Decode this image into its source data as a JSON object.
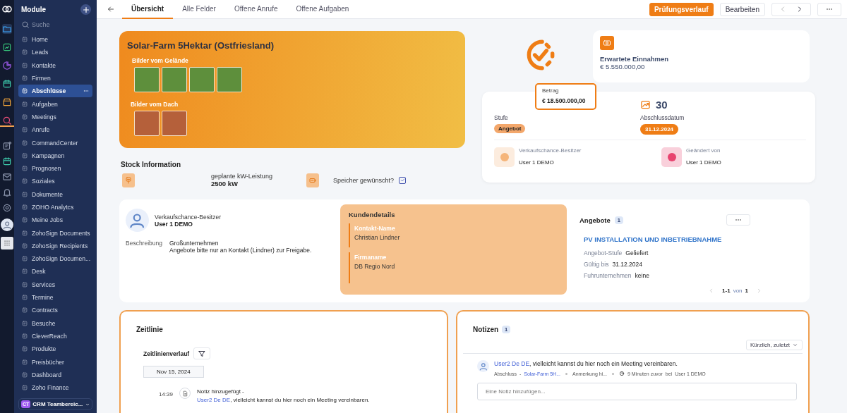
{
  "rail": {
    "top": [
      {
        "kind": "logo",
        "selected": false
      },
      {
        "kind": "folder",
        "selected": true
      },
      {
        "kind": "chart",
        "selected": false
      },
      {
        "kind": "pie",
        "selected": false
      },
      {
        "kind": "calendar",
        "selected": false
      },
      {
        "kind": "store",
        "selected": false
      },
      {
        "kind": "search",
        "selected": false
      }
    ],
    "bottom": [
      {
        "kind": "note"
      },
      {
        "kind": "calendar"
      },
      {
        "kind": "mail"
      },
      {
        "kind": "bell"
      },
      {
        "kind": "gear"
      },
      {
        "kind": "avatar"
      },
      {
        "kind": "apps"
      }
    ]
  },
  "sidebar": {
    "title": "Module",
    "search": {
      "placeholder": "Suche"
    },
    "items": [
      {
        "label": "Home",
        "selected": false
      },
      {
        "label": "Leads",
        "selected": false
      },
      {
        "label": "Kontakte",
        "selected": false
      },
      {
        "label": "Firmen",
        "selected": false
      },
      {
        "label": "Abschlüsse",
        "selected": true
      },
      {
        "label": "Aufgaben",
        "selected": false
      },
      {
        "label": "Meetings",
        "selected": false
      },
      {
        "label": "Anrufe",
        "selected": false
      },
      {
        "label": "CommandCenter",
        "selected": false
      },
      {
        "label": "Kampagnen",
        "selected": false
      },
      {
        "label": "Prognosen",
        "selected": false
      },
      {
        "label": "Soziales",
        "selected": false
      },
      {
        "label": "Dokumente",
        "selected": false
      },
      {
        "label": "ZOHO Analytcs",
        "selected": false
      },
      {
        "label": "Meine Jobs",
        "selected": false
      },
      {
        "label": "ZohoSign Documents",
        "selected": false
      },
      {
        "label": "ZohoSign Recipients",
        "selected": false
      },
      {
        "label": "ZohoSign Documen...",
        "selected": false
      },
      {
        "label": "Desk",
        "selected": false
      },
      {
        "label": "Services",
        "selected": false
      },
      {
        "label": "Termine",
        "selected": false
      },
      {
        "label": "Contracts",
        "selected": false
      },
      {
        "label": "Besuche",
        "selected": false
      },
      {
        "label": "CleverReach",
        "selected": false
      },
      {
        "label": "Produkte",
        "selected": false
      },
      {
        "label": "Preisbücher",
        "selected": false
      },
      {
        "label": "Dashboard",
        "selected": false
      },
      {
        "label": "Zoho Finance",
        "selected": false
      }
    ],
    "workspace": {
      "initials": "CT",
      "label": "CRM Teambereic..."
    }
  },
  "tabs": [
    {
      "label": "Übersicht",
      "selected": true
    },
    {
      "label": "Alle Felder",
      "selected": false
    },
    {
      "label": "Offene Anrufe",
      "selected": false
    },
    {
      "label": "Offene Aufgaben",
      "selected": false
    }
  ],
  "actions": [
    {
      "label": "Prüfungsverlauf",
      "kind": "primary"
    },
    {
      "label": "Bearbeiten",
      "kind": "secondary"
    }
  ],
  "hero": {
    "title": "Solar-Farm 5Hektar (Ostfriesland)",
    "galleries": [
      {
        "label": "Bilder vom Gelände",
        "photos": [
          {
            "kind": "field"
          },
          {
            "kind": "field"
          },
          {
            "kind": "field"
          },
          {
            "kind": "field"
          }
        ]
      },
      {
        "label": "Bilder vom Dach",
        "photos": [
          {
            "kind": "roof"
          },
          {
            "kind": "roof"
          }
        ]
      }
    ]
  },
  "stock_info": {
    "title": "Stock Information",
    "fields": [
      {
        "kind": "plug"
      },
      {
        "kind": "value",
        "label": "geplante kW-Leistung",
        "value": "2500 kW"
      },
      {
        "kind": "battery"
      },
      {
        "kind": "checkbox",
        "label": "Speicher gewünscht?",
        "checked": true
      }
    ]
  },
  "summary": {
    "revenue": {
      "label": "Erwartete Einnahmen",
      "value": "€ 5.550.000,00"
    },
    "amount": {
      "label": "Betrag",
      "value": "€ 18.500.000,00"
    },
    "probability": "30",
    "stage": {
      "label": "Stufe",
      "value": "Angebot"
    },
    "closing": {
      "label": "Abschlussdatum",
      "value": "31.12.2024"
    },
    "people": [
      {
        "label": "Verkaufschance-Besitzer",
        "value": "User 1 DEMO",
        "color": "#f5b57a"
      },
      {
        "label": "Geändert von",
        "value": "User 1 DEMO",
        "color": "#e8436f"
      }
    ]
  },
  "details": {
    "owner": {
      "label": "Verkaufschance-Besitzer",
      "name": "User 1 DEMO"
    },
    "description": {
      "label": "Beschreibung",
      "lines": [
        "Großunternehmen",
        "Angebote bitte nur an Kontakt (Lindner) zur Freigabe."
      ]
    },
    "customer": {
      "title": "Kundendetails",
      "fields": [
        {
          "label": "Kontakt-Name",
          "value": "Christian Lindner"
        },
        {
          "label": "Firmaname",
          "value": "DB Regio Nord"
        }
      ]
    },
    "quotes": {
      "title": "Angebote",
      "count": "1",
      "item_title": "PV INSTALLATION UND INBETRIEBNAHME",
      "fields": [
        {
          "label": "Angebot-Stufe",
          "value": "Geliefert"
        },
        {
          "label": "Gültig bis",
          "value": "31.12.2024"
        },
        {
          "label": "Fuhrunternehmen",
          "value": "keine"
        }
      ],
      "pagination": {
        "range": "1-1",
        "of": "von",
        "total": "1"
      }
    }
  },
  "timeline": {
    "title": "Zeitlinie",
    "history_label": "Zeitlinienverlauf",
    "date": "Nov 15, 2024",
    "entries": [
      {
        "time": "14:39",
        "title": "Notiz hinzugefügt -",
        "author": "User2 De DE",
        "text": ", vielleicht kannst du hier noch ein Meeting vereinbaren."
      }
    ]
  },
  "notes": {
    "title": "Notizen",
    "count": "1",
    "sort": "Kürzlich, zuletzt",
    "items": [
      {
        "author": "User2 De DE",
        "text": ", vielleicht kannst du hier noch ein Meeting vereinbaren.",
        "module": "Abschluss",
        "separator": "-",
        "record": "Solar-Farm 5H...",
        "type": "Anmerkung hi...",
        "time": "9 Minuten zuvor",
        "by": "bei",
        "user": "User 1 DEMO"
      }
    ],
    "placeholder": "Eine Notiz hinzufügen..."
  }
}
